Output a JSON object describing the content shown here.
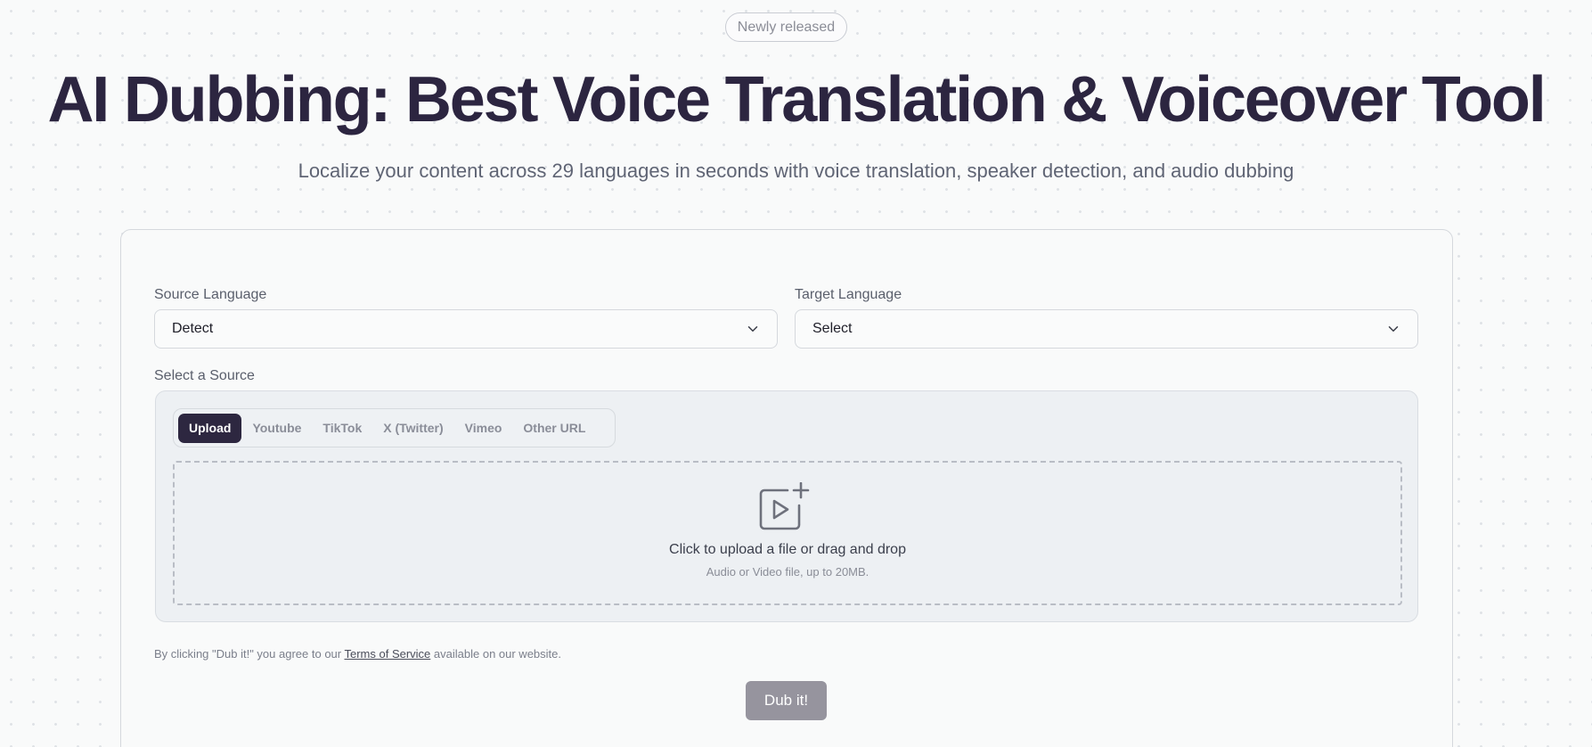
{
  "badge": "Newly released",
  "hero": {
    "title": "AI Dubbing: Best Voice Translation & Voiceover Tool",
    "subtitle": "Localize your content across 29 languages in seconds with voice translation, speaker detection, and audio dubbing"
  },
  "form": {
    "source_language": {
      "label": "Source Language",
      "value": "Detect"
    },
    "target_language": {
      "label": "Target Language",
      "value": "Select"
    },
    "source_label": "Select a Source",
    "tabs": [
      "Upload",
      "Youtube",
      "TikTok",
      "X (Twitter)",
      "Vimeo",
      "Other URL"
    ],
    "active_tab": "Upload",
    "dropzone": {
      "title": "Click to upload a file or drag and drop",
      "subtitle": "Audio or Video file, up to 20MB."
    },
    "terms": {
      "prefix": "By clicking \"Dub it!\" you agree to our ",
      "link": "Terms of Service",
      "suffix": " available on our website."
    },
    "submit_label": "Dub it!"
  },
  "colors": {
    "primary_dark": "#2d2740",
    "button_disabled": "#96949e",
    "panel_bg": "#edf0f3"
  },
  "icons": [
    "chevron-down-icon",
    "video-upload-icon"
  ]
}
